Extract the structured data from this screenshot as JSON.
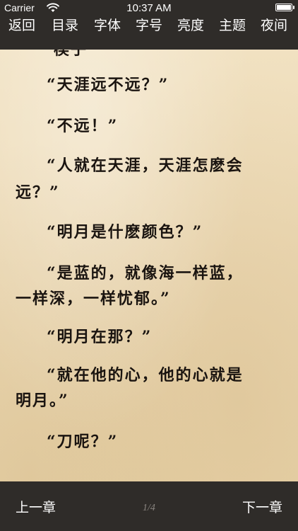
{
  "status_bar": {
    "carrier": "Carrier",
    "time": "10:37 AM",
    "wifi_icon": "wifi-icon",
    "battery_icon": "battery-icon"
  },
  "menu": {
    "back_label": "返回",
    "toc_label": "目录",
    "font_label": "字体",
    "font_size_label": "字号",
    "brightness_label": "亮度",
    "theme_label": "主题",
    "night_label": "夜间"
  },
  "content": {
    "lines": [
      "楔子",
      "“天涯远不远？”",
      "“不远！”",
      "“人就在天涯，天涯怎麽会",
      "远？”",
      "“明月是什麽颜色？”",
      "“是蓝的，就像海一样蓝，",
      "一样深，一样忧郁。”",
      "“明月在那？”",
      "“就在他的心，他的心就是",
      "明月。”",
      "“刀呢？”"
    ]
  },
  "footer": {
    "prev_label": "上一章",
    "page_indicator": "1/4",
    "next_label": "下一章"
  },
  "colors": {
    "bar_background": "#2f2c29",
    "paper": "#ecd9b4",
    "text": "#1a1410"
  }
}
